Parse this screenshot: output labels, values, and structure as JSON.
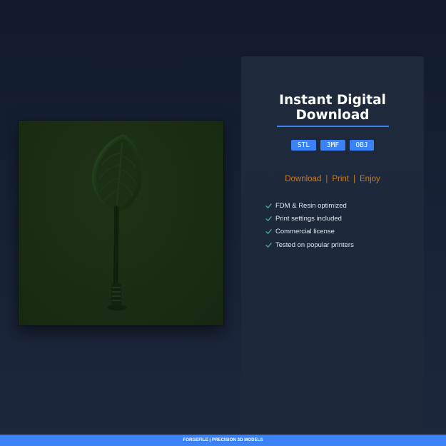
{
  "product_image": {
    "alt": "3D printed leaf paddle model render",
    "background_color": "#1a2d14",
    "model_color": "#1f3a1a"
  },
  "info_panel": {
    "title_line1": "Instant Digital",
    "title_line2": "Download",
    "formats": [
      "STL",
      "3MF",
      "OBJ"
    ],
    "tagline": [
      "Download",
      "Print",
      "Enjoy"
    ],
    "tagline_separator": "|",
    "features": [
      "FDM & Resin optimized",
      "Print settings included",
      "Commercial license",
      "Tested on popular printers"
    ],
    "check_icon": "check-icon"
  },
  "footer": {
    "text": "FORGEFILE | PRECISION 3D MODELS"
  },
  "colors": {
    "accent": "#3b82f6",
    "tagline": "#c97a22",
    "check": "#4fb3a8",
    "panel": "#1e2a3c"
  }
}
